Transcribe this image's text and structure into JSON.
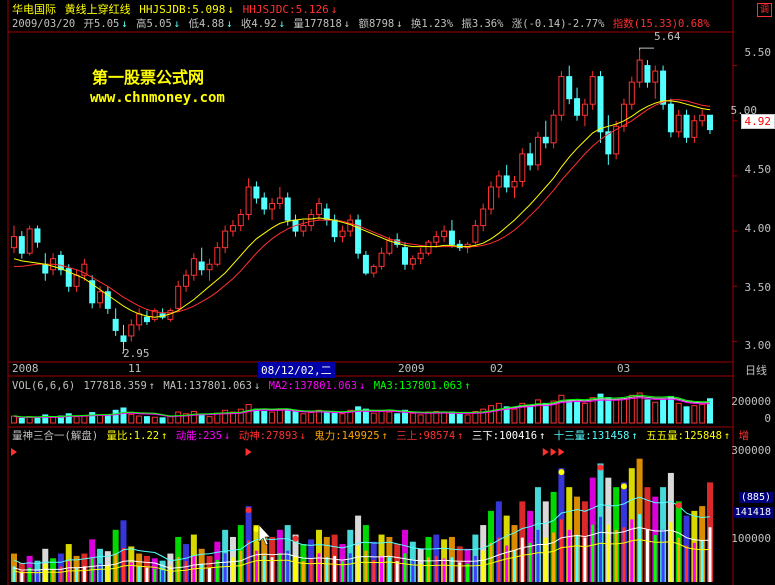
{
  "header1": {
    "name": "华电国际",
    "formula": "黄线上穿红线",
    "hhjs_label": "HHJSJDB:5.098",
    "hhjs2_label": "HHJSJDC:5.126",
    "icon_corner": "调"
  },
  "header2": {
    "date": "2009/03/20",
    "open": "开5.05",
    "high": "高5.05",
    "low": "低4.88",
    "close": "收4.92",
    "vol": "量177818",
    "amount": "额8798",
    "turn": "换1.23%",
    "amp": "振3.36%",
    "chg": "涨(-0.14)-2.77%",
    "index": "指数(15.33)0.68%"
  },
  "watermark": {
    "line1": "第一股票公式网",
    "line2": "www.chnmoney.com"
  },
  "price_axis": [
    "5.50",
    "5.00",
    "4.50",
    "4.00",
    "3.50",
    "3.00"
  ],
  "price_current": "4.92",
  "annot_high": "5.64",
  "annot_low": "2.95",
  "x_labels": [
    "2008",
    "11",
    "08/12/02,二",
    "2009",
    "02",
    "03"
  ],
  "x_right": "日线",
  "vol_header": {
    "title": "VOL(6,6,6)",
    "val": "177818.359",
    "ma1": "MA1:137801.063",
    "ma2": "MA2:137801.063",
    "ma3": "MA3:137801.063"
  },
  "vol_axis": [
    "200000",
    "0"
  ],
  "ind_header": {
    "title": "量神三合一(解盘)",
    "b": "量比:1.22",
    "c": "动能:235",
    "d": "动神:27893",
    "e": "鬼力:149925",
    "f": "三上:98574",
    "g": "三下:100416",
    "h": "十三量:131458",
    "i": "五五量:125848",
    "j": "增"
  },
  "ind_axis": [
    "300000",
    "100000"
  ],
  "ind_badges": [
    "(885)",
    "141418"
  ],
  "colors": {
    "up": "#ff3232",
    "down": "#54ffff",
    "ma_yellow": "#ffff00",
    "ma_red": "#ff3030",
    "orange": "#ffa500"
  },
  "chart_data": [
    {
      "type": "candlestick",
      "ylim": [
        2.85,
        5.75
      ],
      "candles": [
        [
          3.85,
          4.05,
          3.8,
          3.95
        ],
        [
          3.95,
          4.0,
          3.75,
          3.8
        ],
        [
          3.8,
          4.05,
          3.78,
          4.02
        ],
        [
          4.02,
          4.05,
          3.85,
          3.9
        ],
        [
          3.7,
          3.8,
          3.55,
          3.62
        ],
        [
          3.65,
          3.8,
          3.6,
          3.75
        ],
        [
          3.78,
          3.82,
          3.6,
          3.65
        ],
        [
          3.66,
          3.7,
          3.45,
          3.5
        ],
        [
          3.5,
          3.65,
          3.45,
          3.6
        ],
        [
          3.6,
          3.75,
          3.55,
          3.7
        ],
        [
          3.55,
          3.6,
          3.3,
          3.35
        ],
        [
          3.35,
          3.5,
          3.3,
          3.45
        ],
        [
          3.45,
          3.5,
          3.25,
          3.3
        ],
        [
          3.2,
          3.3,
          3.05,
          3.1
        ],
        [
          3.05,
          3.15,
          2.95,
          3.0
        ],
        [
          3.05,
          3.2,
          3.0,
          3.15
        ],
        [
          3.15,
          3.3,
          3.1,
          3.25
        ],
        [
          3.22,
          3.28,
          3.15,
          3.18
        ],
        [
          3.2,
          3.3,
          3.18,
          3.28
        ],
        [
          3.25,
          3.3,
          3.2,
          3.22
        ],
        [
          3.2,
          3.3,
          3.18,
          3.28
        ],
        [
          3.3,
          3.55,
          3.28,
          3.5
        ],
        [
          3.5,
          3.65,
          3.45,
          3.6
        ],
        [
          3.6,
          3.8,
          3.55,
          3.75
        ],
        [
          3.72,
          3.85,
          3.6,
          3.65
        ],
        [
          3.65,
          3.75,
          3.55,
          3.7
        ],
        [
          3.7,
          3.9,
          3.68,
          3.85
        ],
        [
          3.85,
          4.05,
          3.8,
          4.0
        ],
        [
          4.0,
          4.1,
          3.95,
          4.05
        ],
        [
          4.05,
          4.2,
          4.0,
          4.15
        ],
        [
          4.15,
          4.48,
          4.1,
          4.4
        ],
        [
          4.4,
          4.45,
          4.25,
          4.3
        ],
        [
          4.3,
          4.35,
          4.15,
          4.2
        ],
        [
          4.2,
          4.3,
          4.1,
          4.25
        ],
        [
          4.25,
          4.4,
          4.2,
          4.3
        ],
        [
          4.3,
          4.35,
          4.05,
          4.1
        ],
        [
          4.1,
          4.15,
          3.95,
          4.0
        ],
        [
          4.0,
          4.1,
          3.95,
          4.05
        ],
        [
          4.05,
          4.2,
          4.0,
          4.15
        ],
        [
          4.15,
          4.3,
          4.1,
          4.25
        ],
        [
          4.2,
          4.25,
          4.05,
          4.1
        ],
        [
          4.1,
          4.15,
          3.9,
          3.95
        ],
        [
          3.95,
          4.05,
          3.9,
          4.0
        ],
        [
          4.0,
          4.15,
          3.95,
          4.1
        ],
        [
          4.1,
          4.15,
          3.75,
          3.8
        ],
        [
          3.78,
          3.82,
          3.6,
          3.62
        ],
        [
          3.62,
          3.7,
          3.58,
          3.68
        ],
        [
          3.68,
          3.85,
          3.65,
          3.8
        ],
        [
          3.8,
          3.95,
          3.78,
          3.92
        ],
        [
          3.92,
          3.98,
          3.85,
          3.88
        ],
        [
          3.85,
          3.9,
          3.65,
          3.7
        ],
        [
          3.7,
          3.78,
          3.65,
          3.75
        ],
        [
          3.75,
          3.85,
          3.7,
          3.8
        ],
        [
          3.8,
          3.92,
          3.78,
          3.9
        ],
        [
          3.9,
          4.0,
          3.85,
          3.95
        ],
        [
          3.95,
          4.05,
          3.9,
          4.0
        ],
        [
          4.0,
          4.1,
          3.85,
          3.88
        ],
        [
          3.88,
          3.92,
          3.82,
          3.85
        ],
        [
          3.85,
          3.9,
          3.8,
          3.88
        ],
        [
          3.9,
          4.1,
          3.88,
          4.05
        ],
        [
          4.05,
          4.25,
          4.0,
          4.2
        ],
        [
          4.2,
          4.45,
          4.15,
          4.4
        ],
        [
          4.4,
          4.55,
          4.3,
          4.5
        ],
        [
          4.5,
          4.6,
          4.35,
          4.4
        ],
        [
          4.4,
          4.5,
          4.3,
          4.45
        ],
        [
          4.45,
          4.75,
          4.4,
          4.7
        ],
        [
          4.7,
          4.8,
          4.55,
          4.6
        ],
        [
          4.6,
          4.9,
          4.55,
          4.85
        ],
        [
          4.85,
          5.0,
          4.75,
          4.8
        ],
        [
          4.8,
          5.1,
          4.75,
          5.05
        ],
        [
          5.05,
          5.45,
          5.0,
          5.4
        ],
        [
          5.4,
          5.5,
          5.15,
          5.2
        ],
        [
          5.2,
          5.3,
          5.0,
          5.05
        ],
        [
          5.05,
          5.2,
          4.95,
          5.15
        ],
        [
          5.15,
          5.45,
          5.1,
          5.4
        ],
        [
          5.4,
          5.45,
          4.8,
          4.9
        ],
        [
          4.9,
          5.05,
          4.6,
          4.7
        ],
        [
          4.7,
          5.0,
          4.65,
          4.95
        ],
        [
          4.95,
          5.2,
          4.9,
          5.15
        ],
        [
          5.15,
          5.4,
          5.1,
          5.35
        ],
        [
          5.35,
          5.64,
          5.3,
          5.55
        ],
        [
          5.5,
          5.55,
          5.3,
          5.35
        ],
        [
          5.35,
          5.5,
          5.2,
          5.45
        ],
        [
          5.45,
          5.5,
          5.1,
          5.15
        ],
        [
          5.15,
          5.2,
          4.85,
          4.9
        ],
        [
          4.9,
          5.1,
          4.85,
          5.05
        ],
        [
          5.05,
          5.1,
          4.8,
          4.85
        ],
        [
          4.85,
          5.05,
          4.8,
          5.0
        ],
        [
          5.0,
          5.1,
          4.95,
          5.05
        ],
        [
          5.05,
          5.05,
          4.88,
          4.92
        ]
      ],
      "ma_yellow": [
        3.75,
        3.73,
        3.72,
        3.71,
        3.7,
        3.68,
        3.66,
        3.63,
        3.6,
        3.57,
        3.52,
        3.47,
        3.42,
        3.37,
        3.32,
        3.28,
        3.25,
        3.23,
        3.22,
        3.23,
        3.25,
        3.28,
        3.33,
        3.38,
        3.44,
        3.5,
        3.56,
        3.62,
        3.7,
        3.78,
        3.86,
        3.93,
        3.98,
        4.03,
        4.07,
        4.09,
        4.1,
        4.11,
        4.11,
        4.12,
        4.11,
        4.1,
        4.08,
        4.06,
        4.03,
        4.0,
        3.97,
        3.94,
        3.91,
        3.89,
        3.87,
        3.86,
        3.86,
        3.86,
        3.86,
        3.87,
        3.87,
        3.86,
        3.86,
        3.87,
        3.89,
        3.93,
        3.98,
        4.04,
        4.1,
        4.17,
        4.24,
        4.32,
        4.4,
        4.48,
        4.58,
        4.67,
        4.75,
        4.82,
        4.89,
        4.93,
        4.95,
        4.97,
        5.0,
        5.04,
        5.09,
        5.13,
        5.16,
        5.18,
        5.18,
        5.17,
        5.15,
        5.13,
        5.11,
        5.1
      ],
      "ma_red": [
        3.68,
        3.68,
        3.69,
        3.7,
        3.7,
        3.7,
        3.69,
        3.67,
        3.65,
        3.62,
        3.58,
        3.54,
        3.5,
        3.45,
        3.4,
        3.36,
        3.32,
        3.29,
        3.27,
        3.26,
        3.26,
        3.27,
        3.29,
        3.32,
        3.36,
        3.4,
        3.45,
        3.51,
        3.57,
        3.64,
        3.72,
        3.8,
        3.87,
        3.93,
        3.98,
        4.02,
        4.05,
        4.07,
        4.09,
        4.1,
        4.1,
        4.1,
        4.09,
        4.07,
        4.05,
        4.02,
        3.99,
        3.96,
        3.93,
        3.91,
        3.89,
        3.88,
        3.87,
        3.86,
        3.86,
        3.86,
        3.86,
        3.86,
        3.86,
        3.86,
        3.87,
        3.89,
        3.92,
        3.96,
        4.01,
        4.07,
        4.14,
        4.21,
        4.29,
        4.37,
        4.46,
        4.54,
        4.62,
        4.7,
        4.77,
        4.83,
        4.88,
        4.92,
        4.96,
        5.0,
        5.05,
        5.1,
        5.14,
        5.17,
        5.19,
        5.19,
        5.18,
        5.16,
        5.14,
        5.13
      ]
    },
    {
      "type": "bar",
      "ylim": [
        0,
        300000
      ],
      "volume": [
        60,
        40,
        55,
        45,
        70,
        50,
        60,
        80,
        55,
        60,
        90,
        70,
        65,
        110,
        130,
        75,
        60,
        55,
        50,
        45,
        60,
        95,
        80,
        100,
        70,
        55,
        85,
        110,
        95,
        120,
        160,
        120,
        100,
        95,
        110,
        120,
        100,
        80,
        90,
        110,
        95,
        100,
        80,
        110,
        140,
        120,
        85,
        100,
        95,
        80,
        110,
        85,
        70,
        95,
        100,
        90,
        95,
        75,
        70,
        100,
        120,
        150,
        170,
        140,
        120,
        170,
        150,
        200,
        170,
        190,
        240,
        200,
        180,
        170,
        220,
        250,
        220,
        200,
        210,
        240,
        260,
        200,
        180,
        200,
        230,
        170,
        140,
        150,
        160,
        210
      ]
    }
  ]
}
